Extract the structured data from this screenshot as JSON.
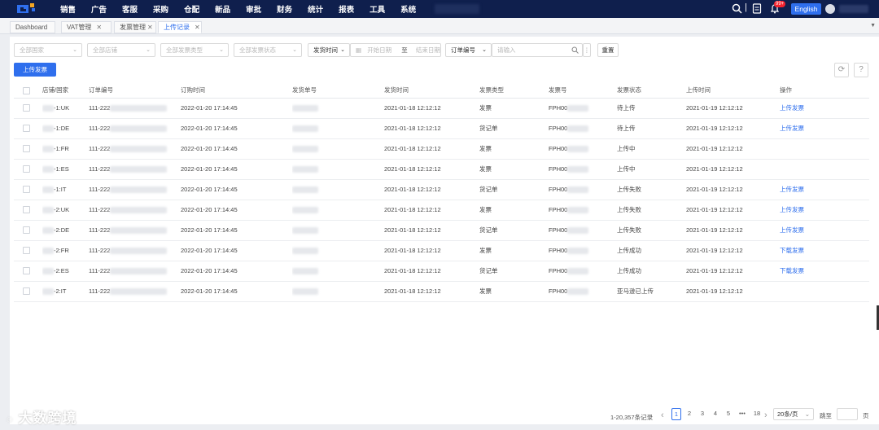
{
  "nav": {
    "items": [
      "销售",
      "广告",
      "客服",
      "采购",
      "仓配",
      "新品",
      "审批",
      "财务",
      "统计",
      "报表",
      "工具",
      "系统"
    ],
    "notification_badge": "99+",
    "language_button": "English"
  },
  "tabs": [
    "Dashboard",
    "VAT管理",
    "发票管理",
    "上传记录"
  ],
  "filters": {
    "country": "全部国家",
    "store": "全部店铺",
    "invoice_type": "全部发票类型",
    "invoice_status": "全部发票状态",
    "time_type": "发货时间",
    "start_date": "开始日期",
    "date_sep": "至",
    "end_date": "结束日期",
    "search_field": "订单编号",
    "search_placeholder": "请输入",
    "reset": "重置"
  },
  "toolbar": {
    "upload_label": "上传发票"
  },
  "table": {
    "headers": [
      "店铺/国家",
      "订单编号",
      "订购时间",
      "发货单号",
      "发货时间",
      "发票类型",
      "发票号",
      "发票状态",
      "上传时间",
      "操作"
    ],
    "rows": [
      {
        "store": "-1:UK",
        "order": "111-222",
        "ordered": "2022-01-20 17:14:45",
        "shipped": "2021-01-18 12:12:12",
        "type": "发票",
        "inv": "FPH00",
        "status": "待上传",
        "uploaded": "2021-01-19 12:12:12",
        "action": "上传发票"
      },
      {
        "store": "-1:DE",
        "order": "111-222",
        "ordered": "2022-01-20 17:14:45",
        "shipped": "2021-01-18 12:12:12",
        "type": "货记单",
        "inv": "FPH00",
        "status": "待上传",
        "uploaded": "2021-01-19 12:12:12",
        "action": "上传发票"
      },
      {
        "store": "-1:FR",
        "order": "111-222",
        "ordered": "2022-01-20 17:14:45",
        "shipped": "2021-01-18 12:12:12",
        "type": "发票",
        "inv": "FPH00",
        "status": "上传中",
        "uploaded": "2021-01-19 12:12:12",
        "action": ""
      },
      {
        "store": "-1:ES",
        "order": "111-222",
        "ordered": "2022-01-20 17:14:45",
        "shipped": "2021-01-18 12:12:12",
        "type": "发票",
        "inv": "FPH00",
        "status": "上传中",
        "uploaded": "2021-01-19 12:12:12",
        "action": ""
      },
      {
        "store": "-1:IT",
        "order": "111-222",
        "ordered": "2022-01-20 17:14:45",
        "shipped": "2021-01-18 12:12:12",
        "type": "货记单",
        "inv": "FPH00",
        "status": "上传失败",
        "uploaded": "2021-01-19 12:12:12",
        "action": "上传发票"
      },
      {
        "store": "-2:UK",
        "order": "111-222",
        "ordered": "2022-01-20 17:14:45",
        "shipped": "2021-01-18 12:12:12",
        "type": "发票",
        "inv": "FPH00",
        "status": "上传失败",
        "uploaded": "2021-01-19 12:12:12",
        "action": "上传发票"
      },
      {
        "store": "-2:DE",
        "order": "111-222",
        "ordered": "2022-01-20 17:14:45",
        "shipped": "2021-01-18 12:12:12",
        "type": "货记单",
        "inv": "FPH00",
        "status": "上传失败",
        "uploaded": "2021-01-19 12:12:12",
        "action": "上传发票"
      },
      {
        "store": "-2:FR",
        "order": "111-222",
        "ordered": "2022-01-20 17:14:45",
        "shipped": "2021-01-18 12:12:12",
        "type": "发票",
        "inv": "FPH00",
        "status": "上传成功",
        "uploaded": "2021-01-19 12:12:12",
        "action": "下载发票"
      },
      {
        "store": "-2:ES",
        "order": "111-222",
        "ordered": "2022-01-20 17:14:45",
        "shipped": "2021-01-18 12:12:12",
        "type": "货记单",
        "inv": "FPH00",
        "status": "上传成功",
        "uploaded": "2021-01-19 12:12:12",
        "action": "下载发票"
      },
      {
        "store": "-2:IT",
        "order": "111-222",
        "ordered": "2022-01-20 17:14:45",
        "shipped": "2021-01-18 12:12:12",
        "type": "发票",
        "inv": "FPH00",
        "status": "亚马逊已上传",
        "uploaded": "2021-01-19 12:12:12",
        "action": ""
      }
    ]
  },
  "pagination": {
    "total": "1-20,357条记录",
    "pages": [
      "1",
      "2",
      "3",
      "4",
      "5",
      "•••",
      "18"
    ],
    "current": "1",
    "page_size": "20条/页",
    "goto_label": "跳至",
    "page_suffix": "页"
  },
  "watermark": "大数跨境"
}
